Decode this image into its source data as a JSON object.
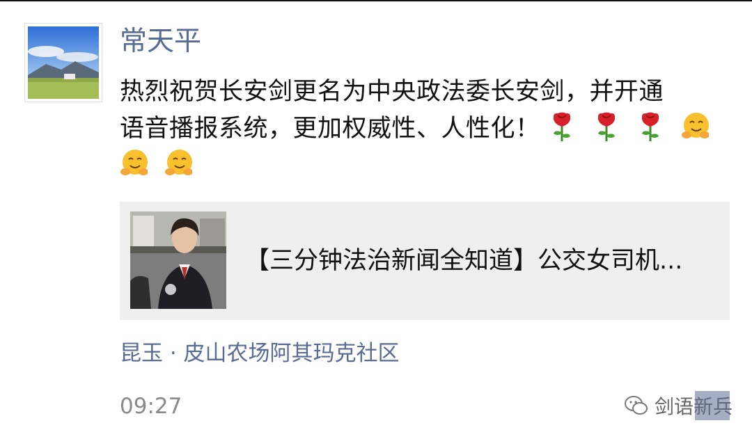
{
  "post": {
    "username": "常天平",
    "text_line1": "热烈祝贺长安剑更名为中央政法委长安剑，并开通",
    "text_line2": "语音播报系统，更加权威性、人性化！",
    "emojis_line2": [
      "rose-emoji",
      "rose-emoji",
      "rose-emoji",
      "hugging-face-emoji"
    ],
    "emojis_line3": [
      "hugging-face-emoji",
      "hugging-face-emoji"
    ],
    "link": {
      "title": "【三分钟法治新闻全知道】公交女司机..."
    },
    "location": "昆玉 · 皮山农场阿其玛克社区",
    "time": "09:27"
  },
  "watermark": {
    "icon": "wechat-icon",
    "text": "剑语新兵"
  },
  "colors": {
    "link_blue": "#576b95",
    "card_bg": "#efefef",
    "time_gray": "#8a8a8a"
  }
}
